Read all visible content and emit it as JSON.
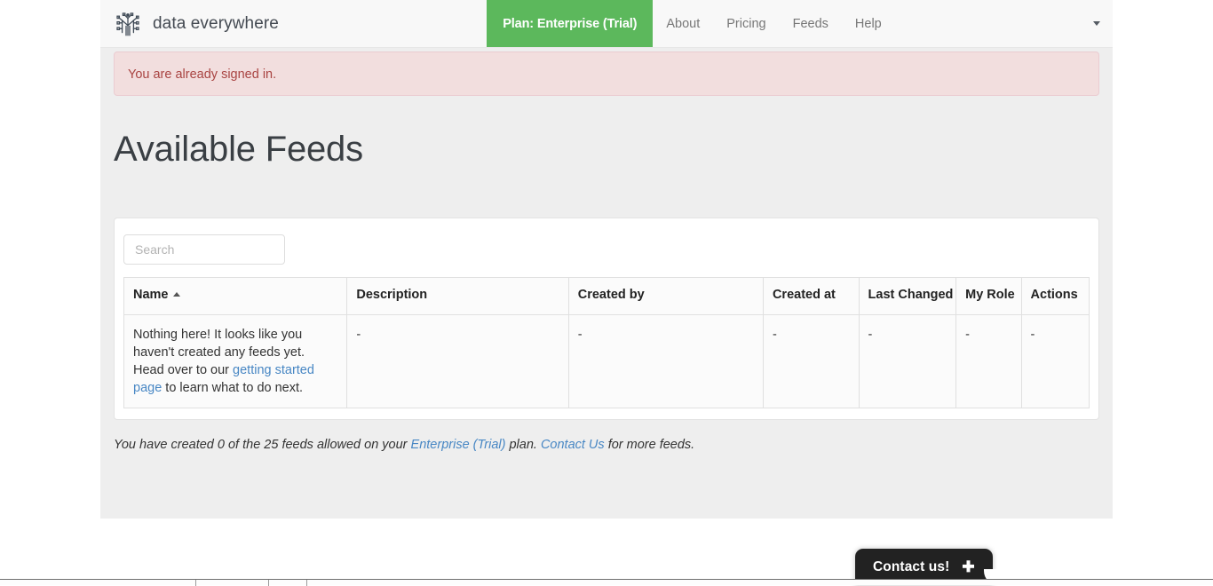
{
  "navbar": {
    "logo_icon": "network-tree-logo-icon",
    "brand": "data everywhere",
    "plan_label": "Plan: Enterprise (Trial)",
    "plan_color": "#5cb85c",
    "items": [
      {
        "label": "About"
      },
      {
        "label": "Pricing"
      },
      {
        "label": "Feeds"
      },
      {
        "label": "Help"
      }
    ],
    "caret_icon": "chevron-down-icon"
  },
  "alert": {
    "message": "You are already signed in.",
    "bg_color": "#f2dede",
    "text_color": "#a94442"
  },
  "page": {
    "title": "Available Feeds"
  },
  "search": {
    "placeholder": "Search",
    "value": ""
  },
  "table": {
    "sort_icon": "sort-ascending-icon",
    "columns": [
      {
        "label": "Name"
      },
      {
        "label": "Description"
      },
      {
        "label": "Created by"
      },
      {
        "label": "Created at"
      },
      {
        "label": "Last Changed"
      },
      {
        "label": "My Role"
      },
      {
        "label": "Actions"
      }
    ],
    "empty_row": {
      "text_before_link": "Nothing here! It looks like you haven't created any feeds yet. Head over to our ",
      "link_text": "getting started page",
      "text_after_link": " to learn what to do next.",
      "description": "-",
      "created_by": "-",
      "created_at": "-",
      "last_changed": "-",
      "my_role": "-",
      "actions": "-"
    }
  },
  "quota": {
    "text_1": "You have created 0 of the 25 feeds allowed on your ",
    "plan_link": "Enterprise (Trial)",
    "text_2": " plan. ",
    "contact_link": "Contact Us",
    "text_3": " for more feeds."
  },
  "contact_widget": {
    "label": "Contact us!",
    "plus_icon": "plus-icon"
  }
}
